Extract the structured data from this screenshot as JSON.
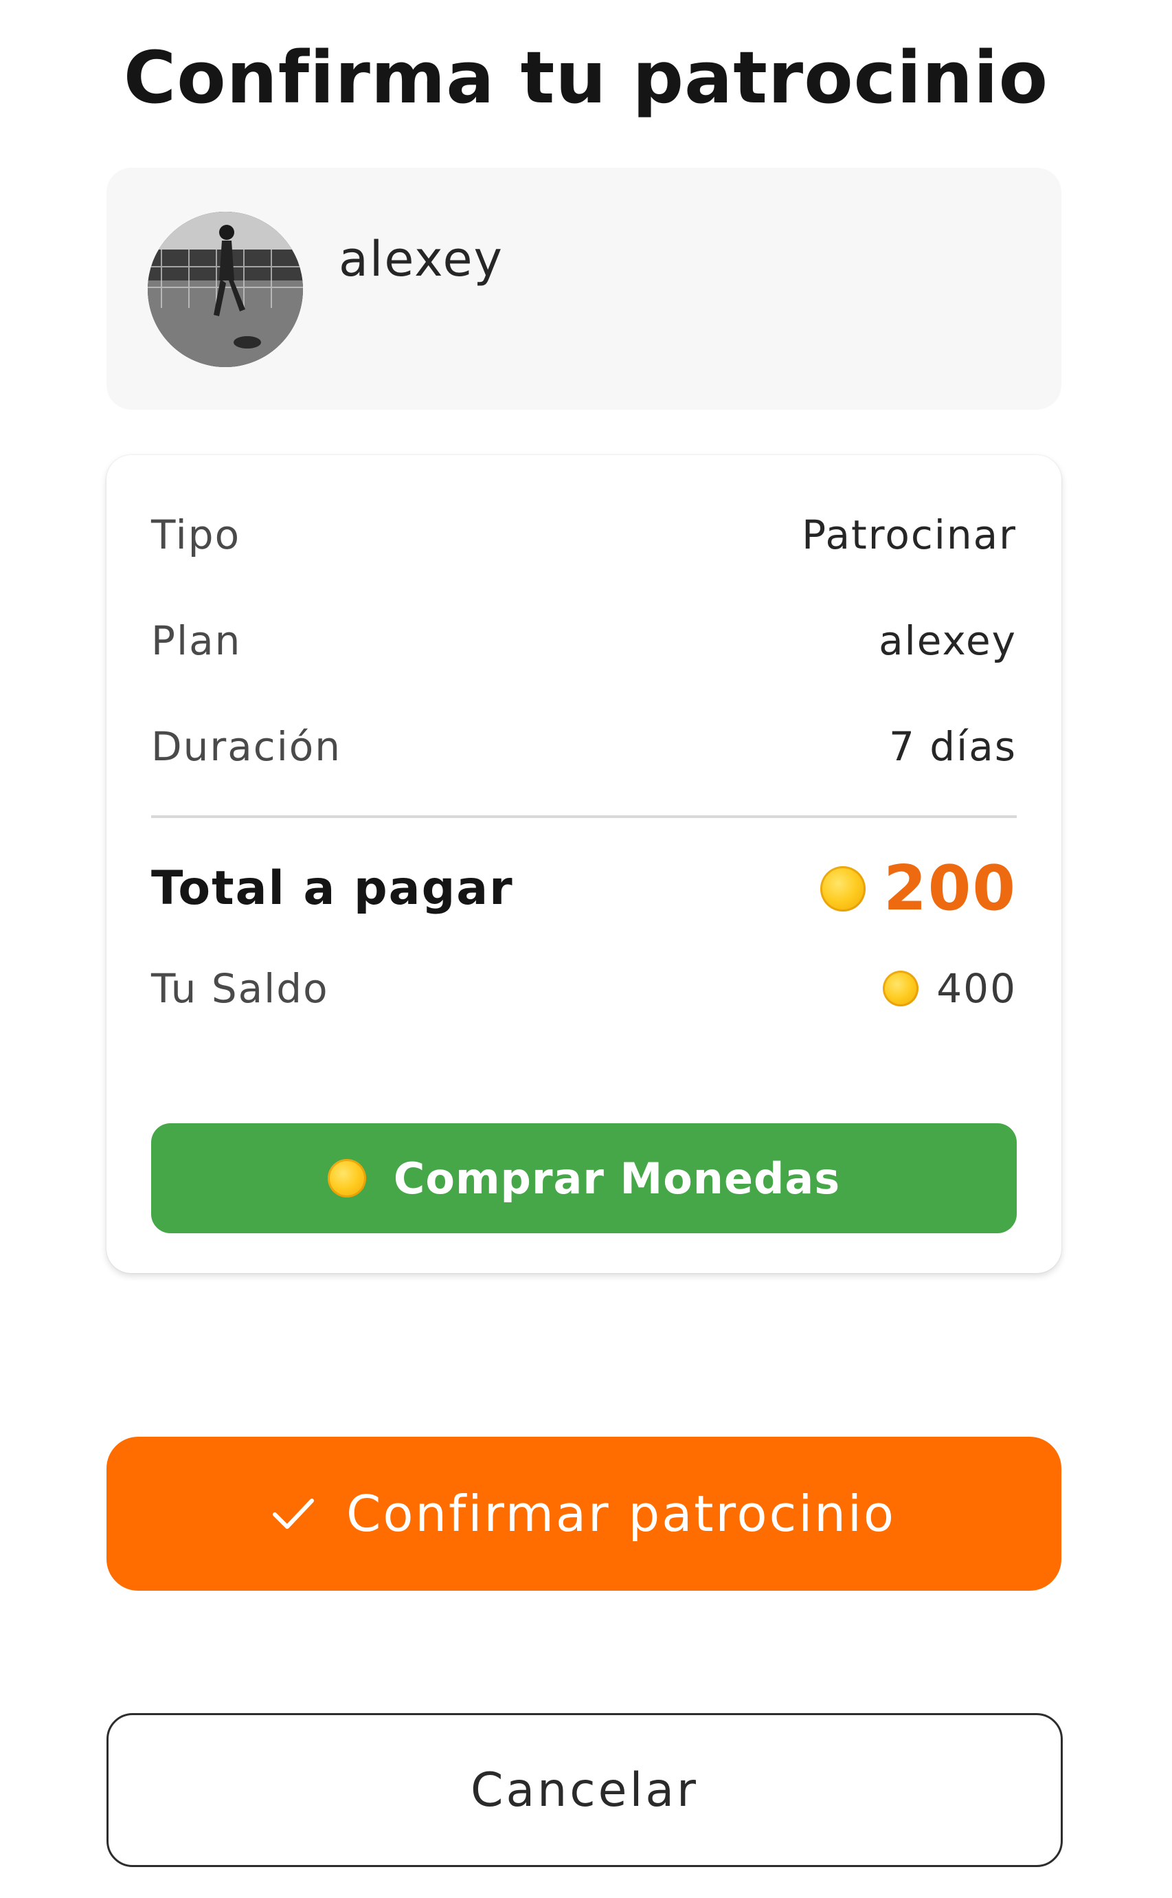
{
  "header": {
    "title": "Confirma tu patrocinio"
  },
  "profile": {
    "name": "alexey",
    "avatar_icon": "user-photo-avatar"
  },
  "details": {
    "rows": [
      {
        "label": "Tipo",
        "value": "Patrocinar"
      },
      {
        "label": "Plan",
        "value": "alexey"
      },
      {
        "label": "Duración",
        "value": "7 días"
      }
    ],
    "total": {
      "label": "Total a pagar",
      "value": "200",
      "icon": "coin-icon"
    },
    "balance": {
      "label": "Tu Saldo",
      "value": "400",
      "icon": "coin-icon"
    }
  },
  "buttons": {
    "buy_coins": "Comprar Monedas",
    "confirm": "Confirmar patrocinio",
    "cancel": "Cancelar"
  },
  "colors": {
    "accent_orange": "#ff6d00",
    "total_orange": "#ee6a10",
    "buy_green": "#45a748",
    "coin_gold": "#ffcc22"
  }
}
